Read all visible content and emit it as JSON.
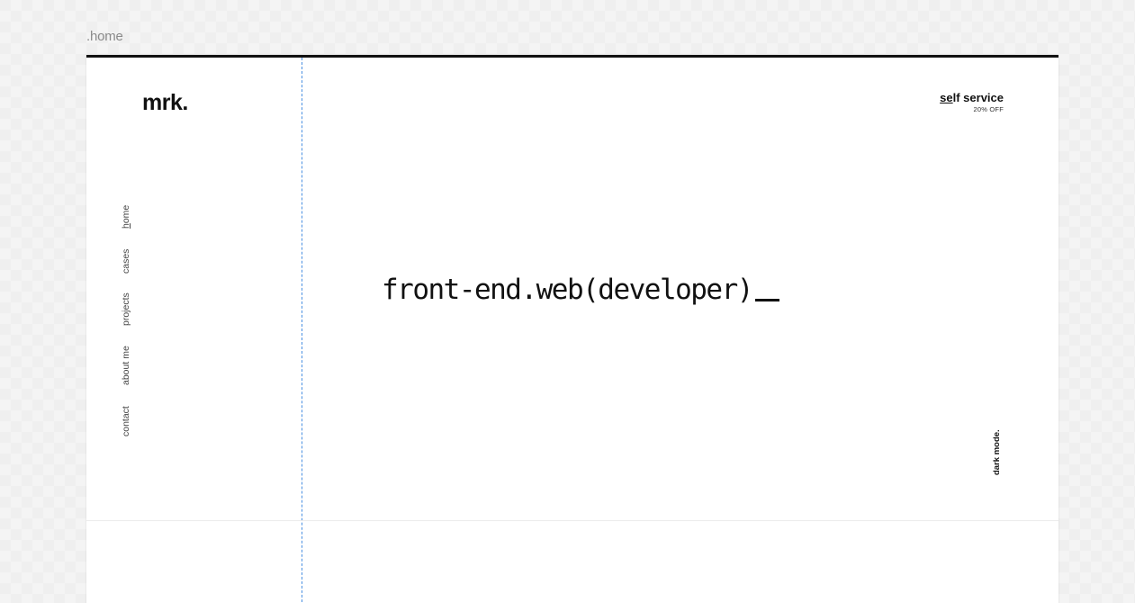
{
  "canvas": {
    "frame_label": ".home"
  },
  "brand": {
    "logo": "mrk."
  },
  "nav": {
    "items": [
      {
        "first": "h",
        "rest": "ome",
        "active": true
      },
      {
        "first": "",
        "rest": "cases",
        "active": false
      },
      {
        "first": "",
        "rest": "projects",
        "active": false
      },
      {
        "first": "",
        "rest": "about me",
        "active": false
      },
      {
        "first": "",
        "rest": "contact",
        "active": false
      }
    ]
  },
  "promo": {
    "label_underlined": "se",
    "label_rest": "lf service",
    "sub": "20% OFF"
  },
  "hero": {
    "headline": "front-end.web(developer)"
  },
  "theme_toggle": {
    "label": "dark mode."
  },
  "colors": {
    "guide_line": "#4a90e2",
    "frame_border": "#111111"
  }
}
